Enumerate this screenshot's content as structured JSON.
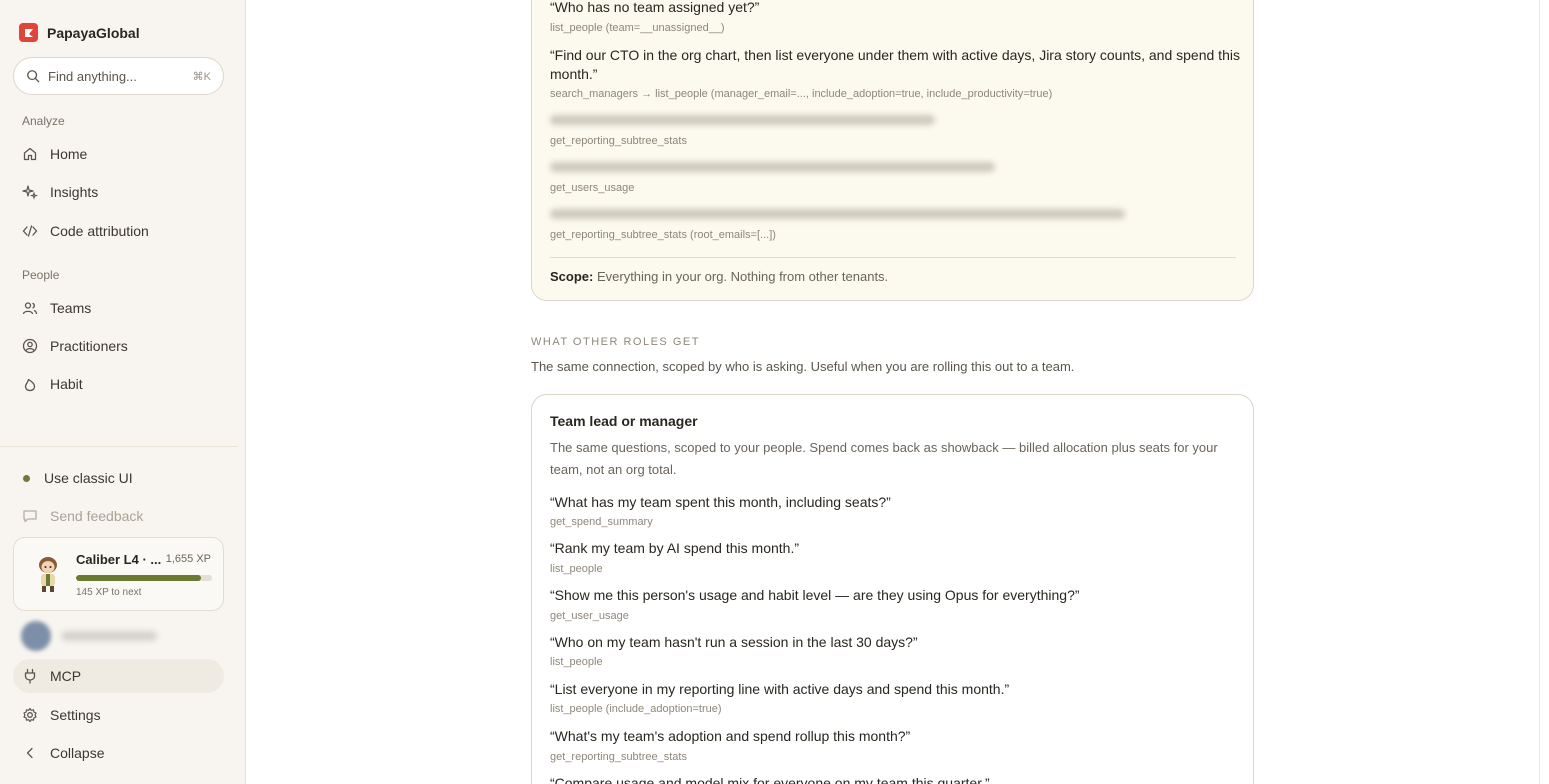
{
  "brand": {
    "name": "PapayaGlobal"
  },
  "search": {
    "placeholder": "Find anything...",
    "shortcut": "⌘K"
  },
  "sidebar": {
    "sections": {
      "analyze": "Analyze",
      "people": "People"
    },
    "analyze_items": [
      {
        "label": "Home",
        "icon": "home-icon"
      },
      {
        "label": "Insights",
        "icon": "sparkles-icon"
      },
      {
        "label": "Code attribution",
        "icon": "code-icon"
      }
    ],
    "people_items": [
      {
        "label": "Teams",
        "icon": "users-icon"
      },
      {
        "label": "Practitioners",
        "icon": "user-circle-icon"
      },
      {
        "label": "Habit",
        "icon": "flame-icon"
      }
    ],
    "classic_ui": "Use classic UI",
    "feedback": "Send feedback",
    "xp": {
      "title": "Caliber L4 · ...",
      "points": "1,655 XP",
      "next": "145 XP to next",
      "progress": 0.92
    },
    "mcp": "MCP",
    "settings": "Settings",
    "collapse": "Collapse"
  },
  "admin_card": {
    "items": [
      {
        "question": "“Who has no team assigned yet?”",
        "tool": "list_people (team=__unassigned__)"
      },
      {
        "question": "“Find our CTO in the org chart, then list everyone under them with active days, Jira story counts, and spend this month.”",
        "tool": "search_managers → list_people (manager_email=..., include_adoption=true, include_productivity=true)"
      },
      {
        "question": "",
        "tool": "get_reporting_subtree_stats"
      },
      {
        "question": "",
        "tool": "get_users_usage"
      },
      {
        "question": "",
        "tool": "get_reporting_subtree_stats (root_emails=[...])"
      }
    ],
    "scope_label": "Scope:",
    "scope_text": "Everything in your org. Nothing from other tenants."
  },
  "other_roles": {
    "eyebrow": "WHAT OTHER ROLES GET",
    "subtext": "The same connection, scoped by who is asking. Useful when you are rolling this out to a team."
  },
  "lead_card": {
    "title": "Team lead or manager",
    "description": "The same questions, scoped to your people. Spend comes back as showback — billed allocation plus seats for your team, not an org total.",
    "items": [
      {
        "question": "“What has my team spent this month, including seats?”",
        "tool": "get_spend_summary"
      },
      {
        "question": "“Rank my team by AI spend this month.”",
        "tool": "list_people"
      },
      {
        "question": "“Show me this person's usage and habit level — are they using Opus for everything?”",
        "tool": "get_user_usage"
      },
      {
        "question": "“Who on my team hasn't run a session in the last 30 days?”",
        "tool": "list_people"
      },
      {
        "question": "“List everyone in my reporting line with active days and spend this month.”",
        "tool": "list_people (include_adoption=true)"
      },
      {
        "question": "“What's my team's adoption and spend rollup this month?”",
        "tool": "get_reporting_subtree_stats"
      },
      {
        "question": "“Compare usage and model mix for everyone on my team this quarter.”",
        "tool": ""
      }
    ]
  }
}
